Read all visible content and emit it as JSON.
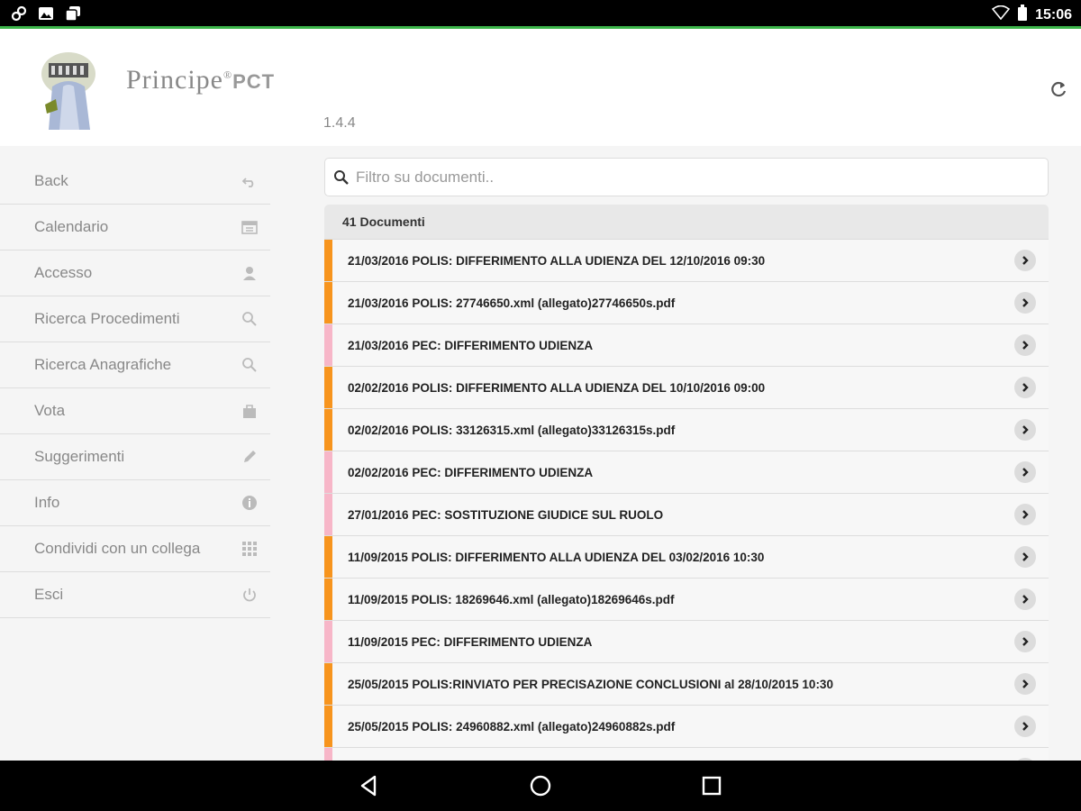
{
  "status_bar": {
    "time": "15:06",
    "left_icons": [
      "link-icon",
      "image-icon",
      "stack-icon"
    ],
    "right_icons": [
      "wifi-icon",
      "battery-icon"
    ]
  },
  "header": {
    "brand_name": "Principe",
    "brand_suffix": "PCT",
    "registered_mark": "®",
    "version": "1.4.4"
  },
  "sidebar": {
    "items": [
      {
        "label": "Back",
        "icon": "back-arrow-icon"
      },
      {
        "label": "Calendario",
        "icon": "calendar-icon"
      },
      {
        "label": "Accesso",
        "icon": "user-icon"
      },
      {
        "label": "Ricerca Procedimenti",
        "icon": "search-icon"
      },
      {
        "label": "Ricerca Anagrafiche",
        "icon": "search-icon"
      },
      {
        "label": "Vota",
        "icon": "bag-icon"
      },
      {
        "label": "Suggerimenti",
        "icon": "pencil-icon"
      },
      {
        "label": "Info",
        "icon": "info-icon"
      },
      {
        "label": "Condividi con un collega",
        "icon": "grid-icon"
      },
      {
        "label": "Esci",
        "icon": "power-icon"
      }
    ]
  },
  "search": {
    "placeholder": "Filtro su documenti..",
    "value": ""
  },
  "documents": {
    "count_label": "41 Documenti",
    "colors": {
      "polis": "#f7941d",
      "pec": "#f7b6c8"
    },
    "rows": [
      {
        "text": "21/03/2016 POLIS: DIFFERIMENTO ALLA UDIENZA DEL 12/10/2016 09:30",
        "kind": "polis"
      },
      {
        "text": "21/03/2016 POLIS: 27746650.xml (allegato)27746650s.pdf",
        "kind": "polis"
      },
      {
        "text": "21/03/2016 PEC: DIFFERIMENTO UDIENZA",
        "kind": "pec"
      },
      {
        "text": "02/02/2016 POLIS: DIFFERIMENTO ALLA UDIENZA DEL 10/10/2016 09:00",
        "kind": "polis"
      },
      {
        "text": "02/02/2016 POLIS: 33126315.xml (allegato)33126315s.pdf",
        "kind": "polis"
      },
      {
        "text": "02/02/2016 PEC: DIFFERIMENTO UDIENZA",
        "kind": "pec"
      },
      {
        "text": "27/01/2016 PEC: SOSTITUZIONE GIUDICE SUL RUOLO",
        "kind": "pec"
      },
      {
        "text": "11/09/2015 POLIS: DIFFERIMENTO ALLA UDIENZA DEL 03/02/2016 10:30",
        "kind": "polis"
      },
      {
        "text": "11/09/2015 POLIS: 18269646.xml (allegato)18269646s.pdf",
        "kind": "polis"
      },
      {
        "text": "11/09/2015 PEC: DIFFERIMENTO UDIENZA",
        "kind": "pec"
      },
      {
        "text": "25/05/2015 POLIS:RINVIATO PER PRECISAZIONE CONCLUSIONI al 28/10/2015 10:30",
        "kind": "polis"
      },
      {
        "text": "25/05/2015 POLIS: 24960882.xml (allegato)24960882s.pdf",
        "kind": "polis"
      },
      {
        "text": "",
        "kind": "pec"
      }
    ]
  },
  "nav_bar": {
    "buttons": [
      "back-triangle-icon",
      "home-circle-icon",
      "recents-square-icon"
    ]
  }
}
